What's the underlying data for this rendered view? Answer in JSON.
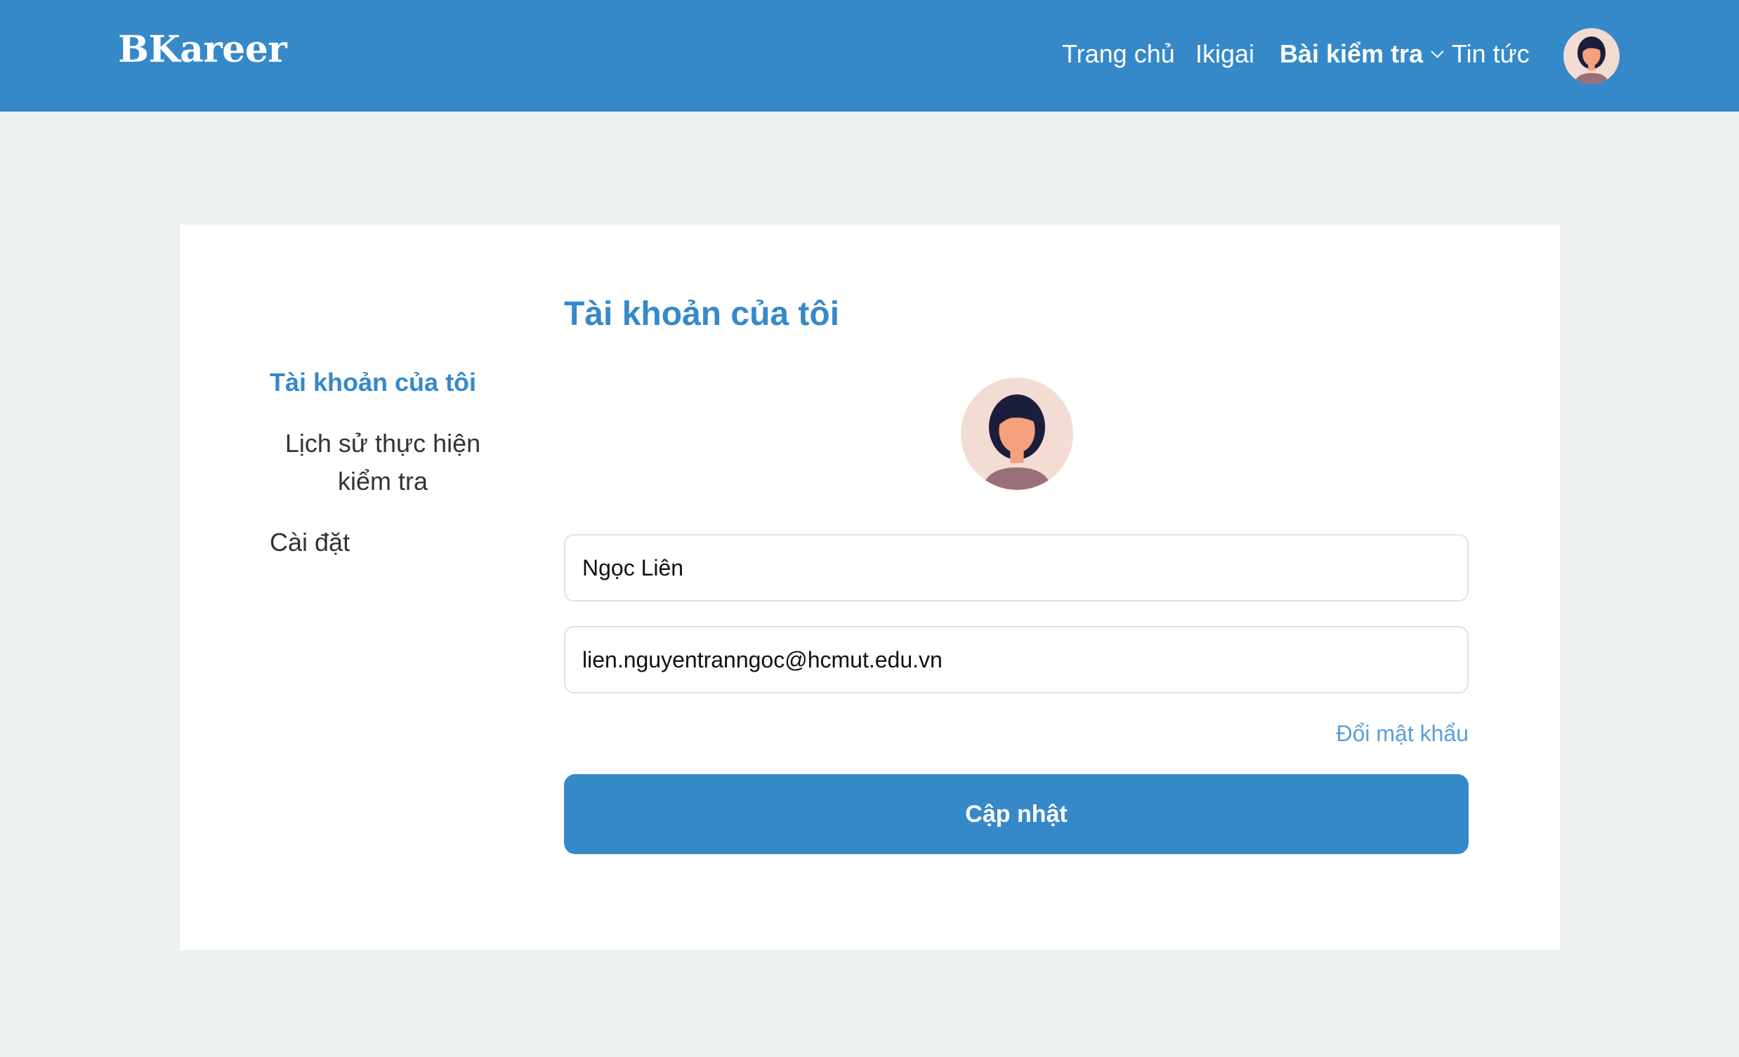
{
  "header": {
    "logo": "BKareer",
    "nav": {
      "home": "Trang chủ",
      "ikigai": "Ikigai",
      "tests": "Bài kiểm tra",
      "news": "Tin tức"
    },
    "dropdown_icon": "chevron-down-icon",
    "avatar_icon": "user-avatar-icon"
  },
  "sidebar": {
    "items": [
      {
        "label": "Tài khoản của tôi",
        "active": true
      },
      {
        "label": "Lịch sử thực hiện kiểm tra",
        "active": false
      },
      {
        "label": "Cài đặt",
        "active": false
      }
    ]
  },
  "main": {
    "title": "Tài khoản của tôi",
    "name_value": "Ngọc Liên",
    "email_value": "lien.nguyentranngoc@hcmut.edu.vn",
    "change_password": "Đổi mật khẩu",
    "update_button": "Cập nhật"
  },
  "colors": {
    "brand": "#3689c9",
    "page_background": "#ecf0f1",
    "link": "#5a9fd6"
  }
}
